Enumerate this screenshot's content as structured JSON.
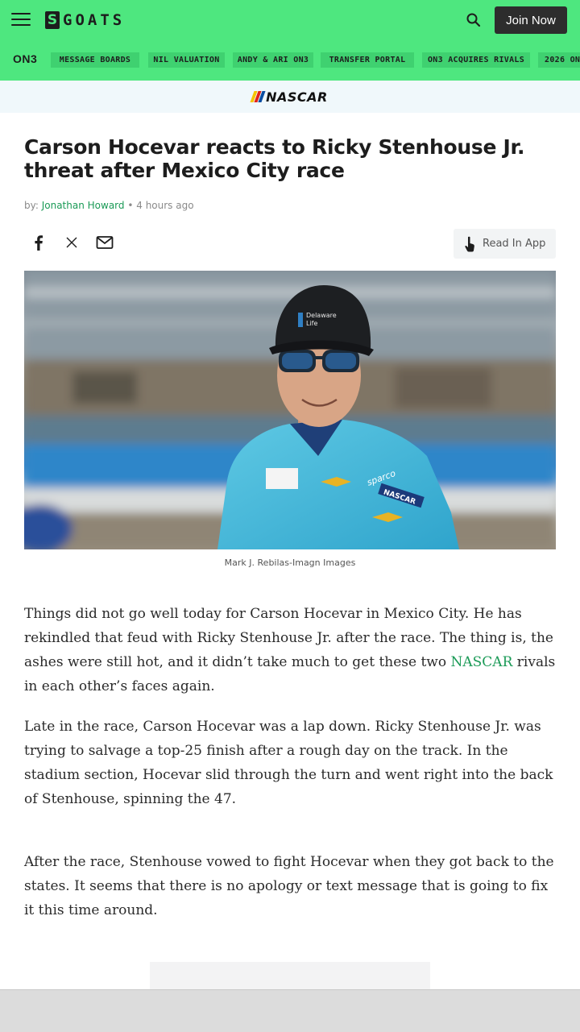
{
  "header": {
    "logo_mark": "S",
    "logo_text": "GOATS",
    "join_label": "Join Now",
    "brand_color": "#4ee77f",
    "icons": {
      "menu": "hamburger-icon",
      "search": "search-icon"
    }
  },
  "nav": {
    "on3_label": "ON3",
    "items": [
      "MESSAGE BOARDS",
      "NIL VALUATION",
      "ANDY & ARI ON3",
      "TRANSFER PORTAL",
      "ON3 ACQUIRES RIVALS",
      "2026 ON"
    ]
  },
  "category": {
    "label": "NASCAR"
  },
  "article": {
    "headline": "Carson Hocevar reacts to Ricky Stenhouse Jr. threat after Mexico City race",
    "by_prefix": "by:",
    "author": "Jonathan Howard",
    "separator": "•",
    "time": "4 hours ago",
    "share_icons": [
      "facebook-icon",
      "x-icon",
      "email-icon"
    ],
    "read_in_app": "Read In App",
    "image_caption": "Mark J. Rebilas-Imagn Images",
    "p1_a": "Things did not go well today for Carson Hocevar in Mexico City. He has rekindled that feud with Ricky Stenhouse Jr. after the race. The thing is, the ashes were still hot, and it didn’t take much to get these two ",
    "p1_link": "NASCAR",
    "p1_b": " rivals in each other’s faces again.",
    "p2": "Late in the race, Carson Hocevar was a lap down. Ricky Stenhouse Jr. was trying to salvage a top-25 finish after a rough day on the track. In the stadium section, Hocevar slid through the turn and went right into the back of Stenhouse, spinning the 47.",
    "p3": "After the race, Stenhouse vowed to fight Hocevar when they got back to the states. It seems that there is no apology or text message that is going to fix it this time around."
  },
  "image_text": {
    "cap_line1": "Delaware",
    "cap_line2": "Life",
    "suit_sparco": "sparco",
    "suit_nascar": "NASCAR"
  }
}
